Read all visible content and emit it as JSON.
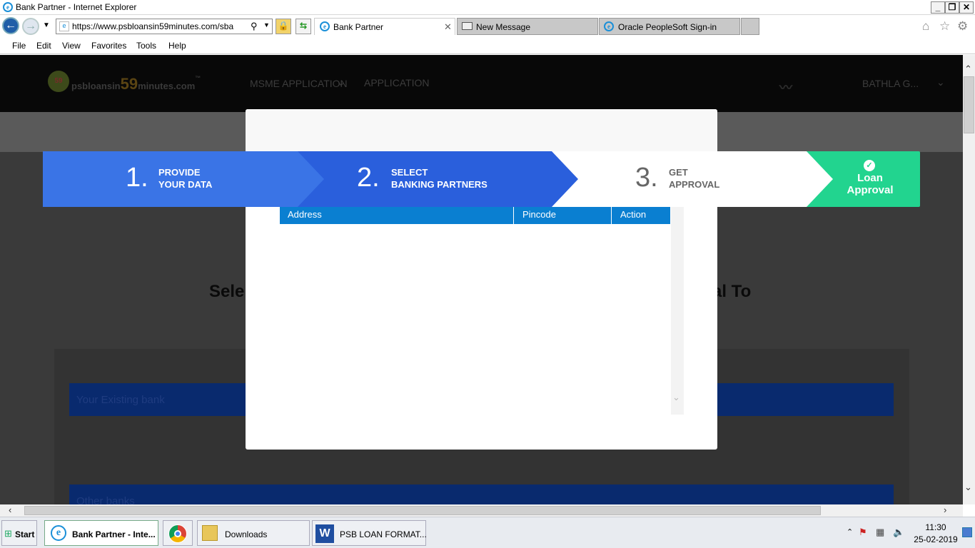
{
  "window": {
    "title": "Bank Partner - Internet Explorer"
  },
  "browser": {
    "url": "https://www.psbloansin59minutes.com/sbank",
    "tabs": [
      {
        "label": "Bank Partner",
        "active": true
      },
      {
        "label": "New Message",
        "active": false
      },
      {
        "label": "Oracle PeopleSoft Sign-in",
        "active": false
      }
    ],
    "menu": [
      "File",
      "Edit",
      "View",
      "Favorites",
      "Tools",
      "Help"
    ]
  },
  "site": {
    "logo": {
      "text_a": "psbloansin",
      "text_b": "59",
      "text_c": "minutes.com",
      "tm": "™",
      "badge": "59"
    },
    "nav": [
      "MSME APPLICATION",
      "APPLICATION"
    ],
    "user": "BATHLA G...",
    "heading_left": "Sele",
    "heading_right": "al To",
    "existing_bank": "Your Existing bank",
    "other_banks": "Other banks"
  },
  "stepper": {
    "steps": [
      {
        "num": "1.",
        "line1": "PROVIDE",
        "line2": "YOUR DATA"
      },
      {
        "num": "2.",
        "line1": "SELECT",
        "line2": "BANKING PARTNERS"
      },
      {
        "num": "3.",
        "line1": "GET",
        "line2": "APPROVAL"
      }
    ],
    "final": {
      "line1": "Loan",
      "line2": "Approval"
    },
    "colors": {
      "step1": "#3a74e6",
      "step2": "#2a5fdc",
      "step3": "#ffffff",
      "final": "#22d48f"
    }
  },
  "modal": {
    "columns": [
      "Address",
      "Pincode",
      "Action"
    ],
    "header_color": "#0a7fd1"
  },
  "taskbar": {
    "start": "Start",
    "items": [
      {
        "label": "Bank Partner - Inte...",
        "icon": "ie-icon"
      },
      {
        "label": "",
        "icon": "chrome-icon"
      },
      {
        "label": "Downloads",
        "icon": "folder-icon"
      },
      {
        "label": "PSB LOAN FORMAT...",
        "icon": "word-icon"
      }
    ],
    "time": "11:30",
    "date": "25-02-2019"
  }
}
